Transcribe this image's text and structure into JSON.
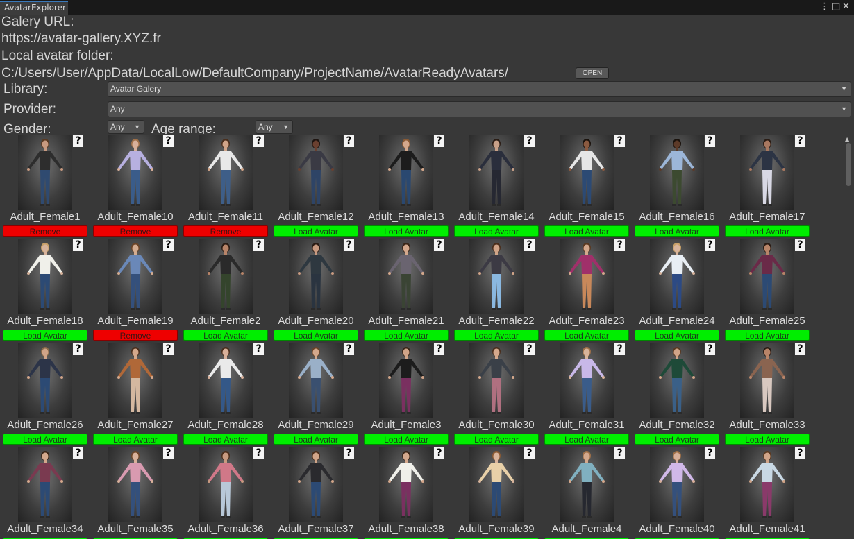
{
  "window": {
    "tab_title": "AvatarExplorer",
    "menu_icon": "kebab-menu-icon",
    "close_icon": "close-icon"
  },
  "header": {
    "gallery_url_label": "Galery URL:",
    "gallery_url": "https://avatar-gallery.XYZ.fr",
    "local_folder_label": "Local avatar folder:",
    "local_folder_path": "C:/Users/User/AppData/LocalLow/DefaultCompany/ProjectName/AvatarReadyAvatars/",
    "open_button": "OPEN"
  },
  "filters": {
    "library_label": "Library:",
    "library_value": "Avatar Galery",
    "provider_label": "Provider:",
    "provider_value": "Any",
    "gender_label": "Gender:",
    "gender_value": "Any",
    "age_label": "Age range:",
    "age_value": "Any"
  },
  "help_glyph": "?",
  "avatars": [
    {
      "name": "Adult_Female1",
      "action": "Remove",
      "top": "#2d2d2d",
      "pants": "#2f4a70",
      "skin": "#c89a80",
      "hair": "#5a3a22"
    },
    {
      "name": "Adult_Female10",
      "action": "Remove",
      "top": "#b7b0e0",
      "pants": "#3a5c8a",
      "skin": "#d8b09a",
      "hair": "#a07048"
    },
    {
      "name": "Adult_Female11",
      "action": "Remove",
      "top": "#e8e8e8",
      "pants": "#3e5e88",
      "skin": "#d0a488",
      "hair": "#4a2e1c"
    },
    {
      "name": "Adult_Female12",
      "action": "Load Avatar",
      "top": "#3a3a44",
      "pants": "#2e4466",
      "skin": "#6a4030",
      "hair": "#1e1410"
    },
    {
      "name": "Adult_Female13",
      "action": "Load Avatar",
      "top": "#1c1c1c",
      "pants": "#2a4870",
      "skin": "#d4a88c",
      "hair": "#8a5a34"
    },
    {
      "name": "Adult_Female14",
      "action": "Load Avatar",
      "top": "#2a2e3c",
      "pants": "#262832",
      "skin": "#c8a088",
      "hair": "#2a1c14"
    },
    {
      "name": "Adult_Female15",
      "action": "Load Avatar",
      "top": "#e6e6e6",
      "pants": "#2c4a74",
      "skin": "#8a5a40",
      "hair": "#1a120c"
    },
    {
      "name": "Adult_Female16",
      "action": "Load Avatar",
      "top": "#9cb6d8",
      "pants": "#3c4a30",
      "skin": "#5c3a28",
      "hair": "#1a120c"
    },
    {
      "name": "Adult_Female17",
      "action": "Load Avatar",
      "top": "#2c3444",
      "pants": "#d8d8e4",
      "skin": "#a87860",
      "hair": "#2a1c14"
    },
    {
      "name": "Adult_Female18",
      "action": "Load Avatar",
      "top": "#f0f0ea",
      "pants": "#2c4a74",
      "skin": "#d8b49c",
      "hair": "#c8a068"
    },
    {
      "name": "Adult_Female19",
      "action": "Remove",
      "top": "#6a88b8",
      "pants": "#34507c",
      "skin": "#d4ac90",
      "hair": "#6a4428"
    },
    {
      "name": "Adult_Female2",
      "action": "Load Avatar",
      "top": "#2a2a2a",
      "pants": "#34442c",
      "skin": "#b88468",
      "hair": "#2a1c14"
    },
    {
      "name": "Adult_Female20",
      "action": "Load Avatar",
      "top": "#2e3840",
      "pants": "#2a3440",
      "skin": "#c89a80",
      "hair": "#2a1c14"
    },
    {
      "name": "Adult_Female21",
      "action": "Load Avatar",
      "top": "#6a6470",
      "pants": "#3a4434",
      "skin": "#d4a88c",
      "hair": "#3a2618"
    },
    {
      "name": "Adult_Female22",
      "action": "Load Avatar",
      "top": "#3c3a44",
      "pants": "#8ab8e0",
      "skin": "#d0a488",
      "hair": "#4a2e1c"
    },
    {
      "name": "Adult_Female23",
      "action": "Load Avatar",
      "top": "#a0306a",
      "pants": "#c8885a",
      "skin": "#d4a88c",
      "hair": "#5a3a22"
    },
    {
      "name": "Adult_Female24",
      "action": "Load Avatar",
      "top": "#e8eef4",
      "pants": "#2c4a84",
      "skin": "#d8b49c",
      "hair": "#c8a068"
    },
    {
      "name": "Adult_Female25",
      "action": "Load Avatar",
      "top": "#6a2a48",
      "pants": "#2c4a74",
      "skin": "#b88468",
      "hair": "#2a1c14"
    },
    {
      "name": "Adult_Female26",
      "action": "Load Avatar",
      "top": "#2c3448",
      "pants": "#2c4a74",
      "skin": "#d0a488",
      "hair": "#8a6a48"
    },
    {
      "name": "Adult_Female27",
      "action": "Load Avatar",
      "top": "#b06838",
      "pants": "#d4b8a0",
      "skin": "#d4a88c",
      "hair": "#4a2e1c"
    },
    {
      "name": "Adult_Female28",
      "action": "Load Avatar",
      "top": "#eaeaea",
      "pants": "#345888",
      "skin": "#d8b09a",
      "hair": "#4a2e1c"
    },
    {
      "name": "Adult_Female29",
      "action": "Load Avatar",
      "top": "#9ab0c8",
      "pants": "#3a5070",
      "skin": "#d4a88c",
      "hair": "#6a4428"
    },
    {
      "name": "Adult_Female3",
      "action": "Load Avatar",
      "top": "#1c1c1c",
      "pants": "#7a3060",
      "skin": "#d0a488",
      "hair": "#3a2618"
    },
    {
      "name": "Adult_Female30",
      "action": "Load Avatar",
      "top": "#3a4048",
      "pants": "#b07080",
      "skin": "#d4a88c",
      "hair": "#4a2e1c"
    },
    {
      "name": "Adult_Female31",
      "action": "Load Avatar",
      "top": "#c8b8e8",
      "pants": "#3a5c8a",
      "skin": "#d8b49c",
      "hair": "#a07048"
    },
    {
      "name": "Adult_Female32",
      "action": "Load Avatar",
      "top": "#1e4a38",
      "pants": "#3a6088",
      "skin": "#d0a488",
      "hair": "#5a3a22"
    },
    {
      "name": "Adult_Female33",
      "action": "Load Avatar",
      "top": "#8a6450",
      "pants": "#d8c8c0",
      "skin": "#b88468",
      "hair": "#2a1c14"
    },
    {
      "name": "Adult_Female34",
      "action": "Load Avatar",
      "top": "#7a3a50",
      "pants": "#2c4a74",
      "skin": "#d4a88c",
      "hair": "#3a2618"
    },
    {
      "name": "Adult_Female35",
      "action": "Load Avatar",
      "top": "#d89ab0",
      "pants": "#34507c",
      "skin": "#d8b09a",
      "hair": "#6a4428"
    },
    {
      "name": "Adult_Female36",
      "action": "Load Avatar",
      "top": "#d07888",
      "pants": "#b8c8d8",
      "skin": "#c89a80",
      "hair": "#4a2e1c"
    },
    {
      "name": "Adult_Female37",
      "action": "Load Avatar",
      "top": "#2a2a2e",
      "pants": "#2c4a74",
      "skin": "#d0a488",
      "hair": "#4a2e1c"
    },
    {
      "name": "Adult_Female38",
      "action": "Load Avatar",
      "top": "#f0f0ea",
      "pants": "#7a3060",
      "skin": "#d4a88c",
      "hair": "#3a2618"
    },
    {
      "name": "Adult_Female39",
      "action": "Load Avatar",
      "top": "#e8d0a8",
      "pants": "#2c4a74",
      "skin": "#d8b49c",
      "hair": "#8a5a34"
    },
    {
      "name": "Adult_Female4",
      "action": "Load Avatar",
      "top": "#80b0c0",
      "pants": "#262830",
      "skin": "#d4a88c",
      "hair": "#a07048"
    },
    {
      "name": "Adult_Female40",
      "action": "Load Avatar",
      "top": "#d0b8e8",
      "pants": "#34507c",
      "skin": "#d8b09a",
      "hair": "#a07048"
    },
    {
      "name": "Adult_Female41",
      "action": "Load Avatar",
      "top": "#c8d8e4",
      "pants": "#8a3a6a",
      "skin": "#d0a488",
      "hair": "#5a3a22"
    }
  ]
}
